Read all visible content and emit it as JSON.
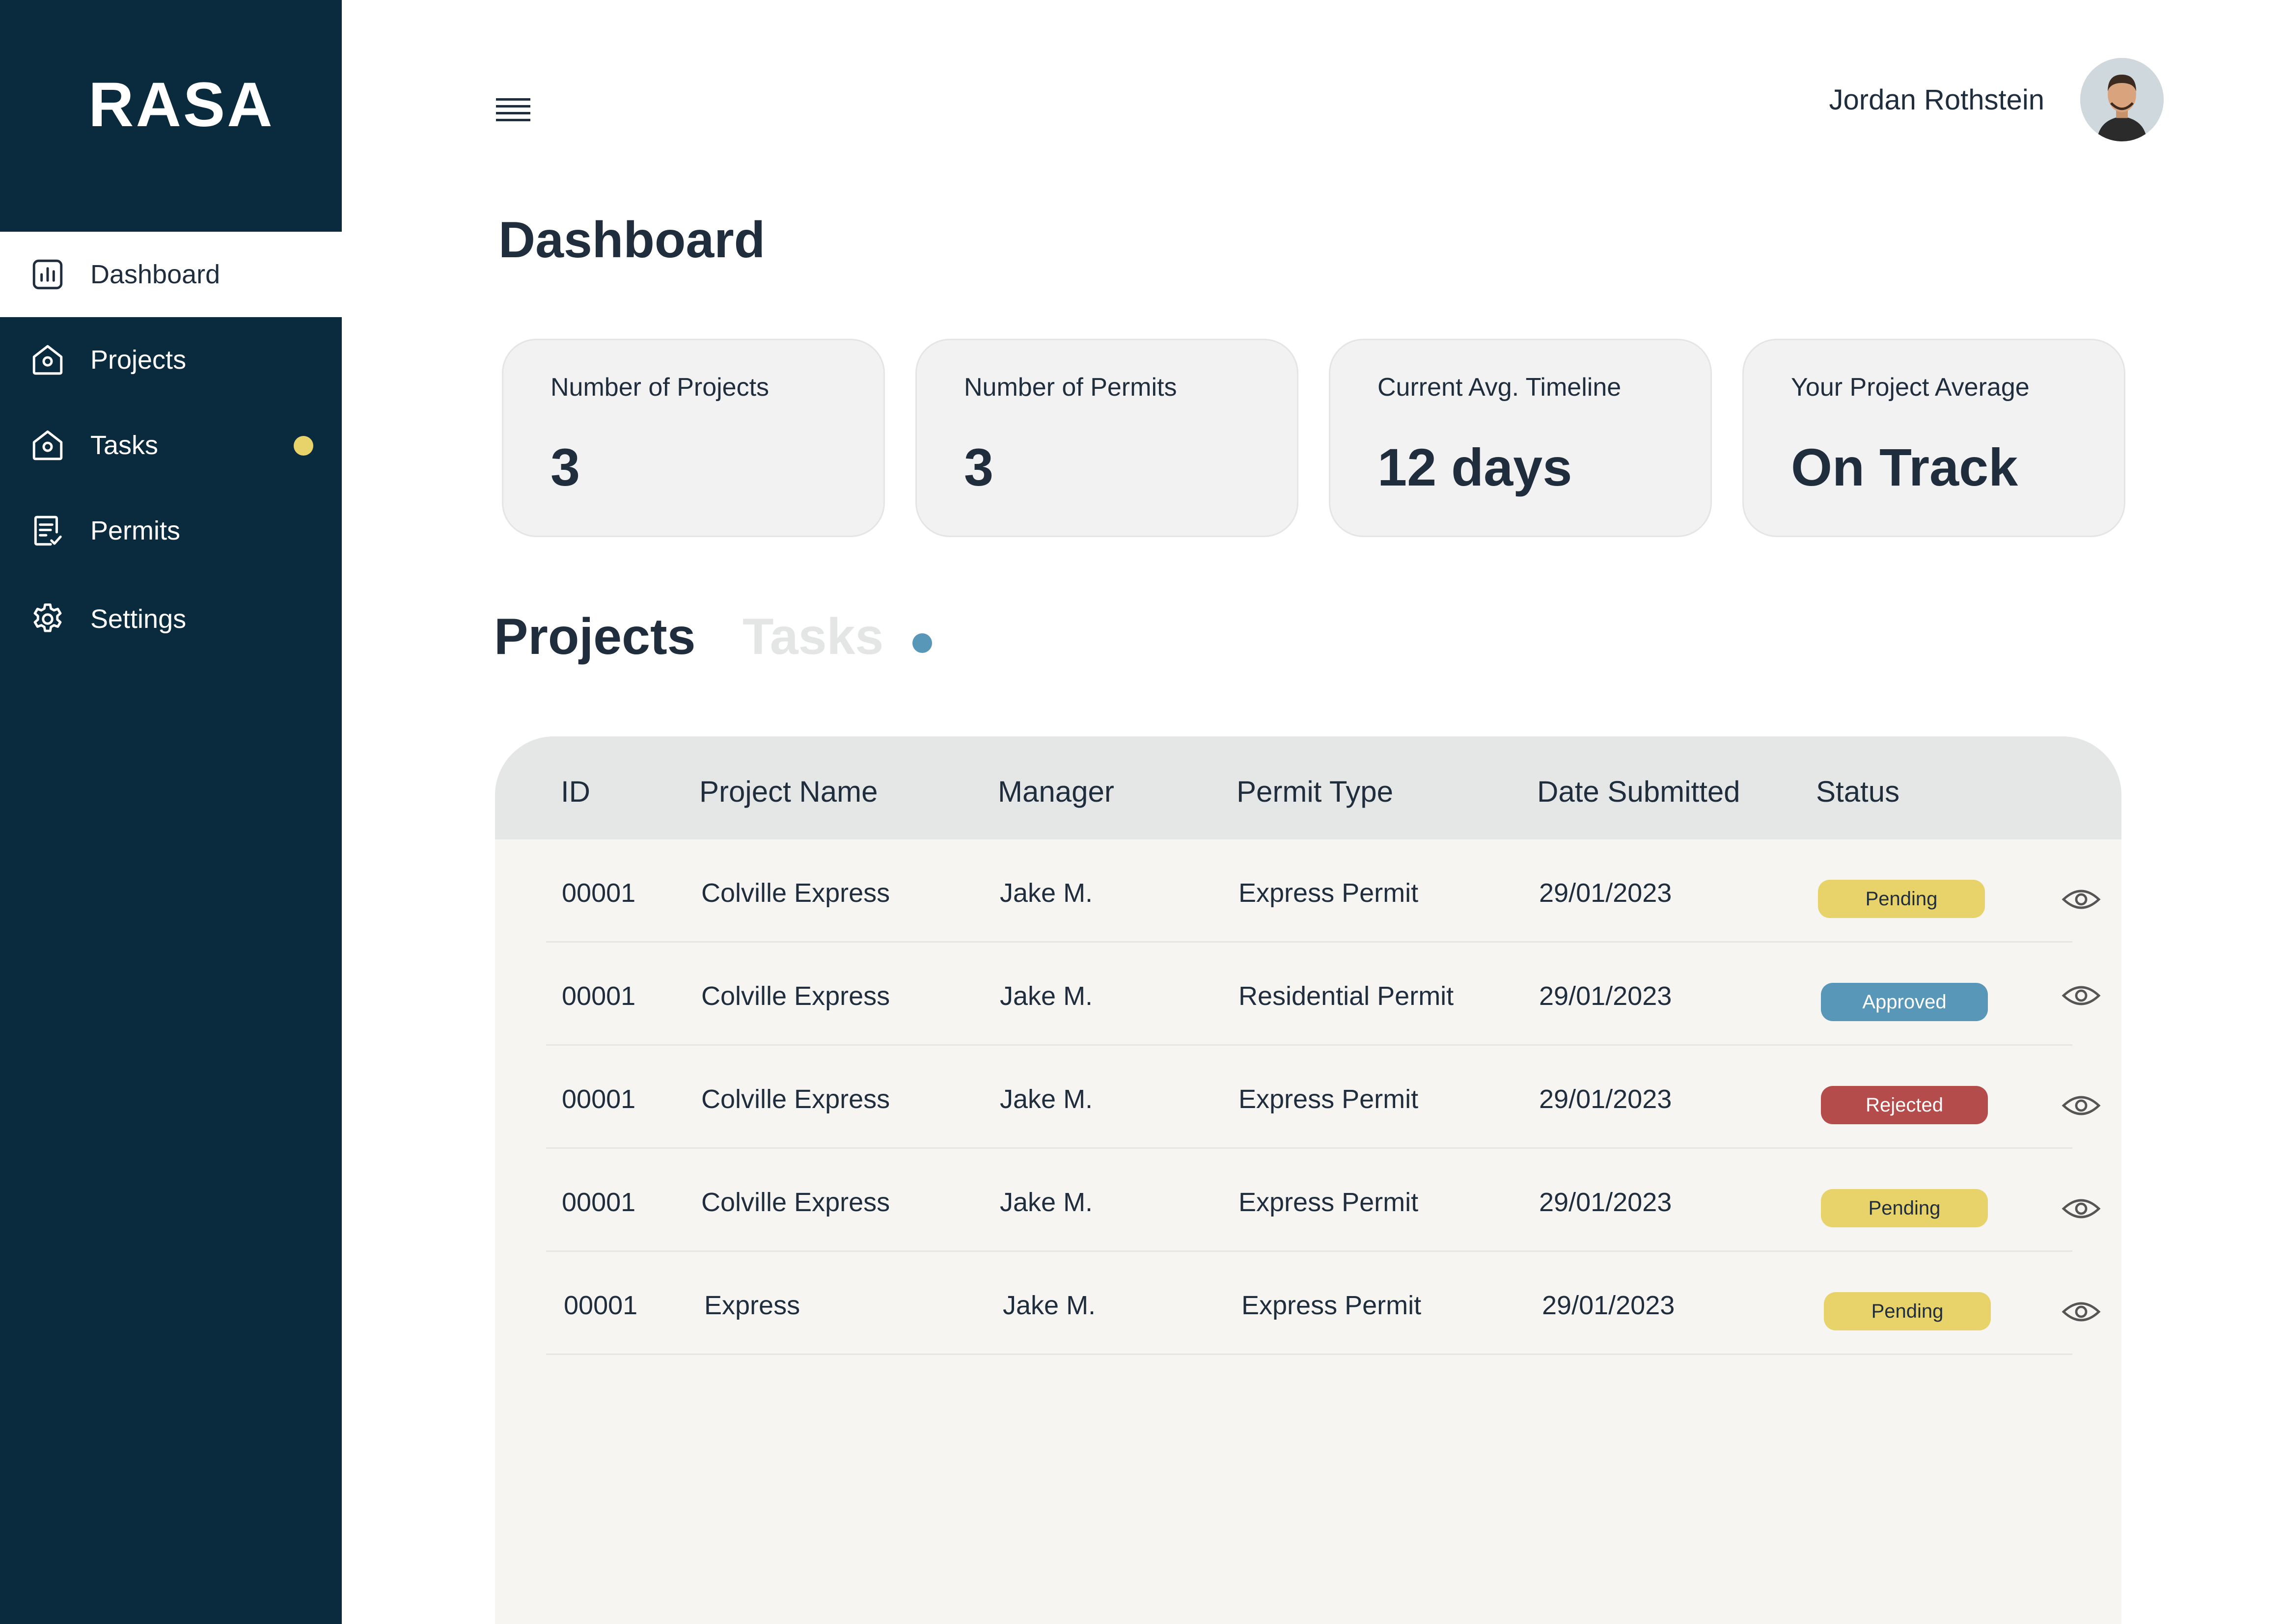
{
  "app": {
    "logo": "RASA"
  },
  "sidebar": {
    "items": [
      {
        "label": "Dashboard",
        "icon": "bar-chart-icon",
        "active": true
      },
      {
        "label": "Projects",
        "icon": "house-icon",
        "active": false
      },
      {
        "label": "Tasks",
        "icon": "house-icon",
        "active": false,
        "notification_dot": true
      },
      {
        "label": "Permits",
        "icon": "document-check-icon",
        "active": false
      },
      {
        "label": "Settings",
        "icon": "gear-icon",
        "active": false
      }
    ]
  },
  "header": {
    "menu_icon": "hamburger-menu-icon",
    "user_name": "Jordan Rothstein",
    "avatar_icon": "user-avatar"
  },
  "page": {
    "title": "Dashboard"
  },
  "stats": [
    {
      "label": "Number of Projects",
      "value": "3"
    },
    {
      "label": "Number of Permits",
      "value": "3"
    },
    {
      "label": "Current Avg. Timeline",
      "value": "12 days"
    },
    {
      "label": "Your Project Average",
      "value": "On Track"
    }
  ],
  "tabs": [
    {
      "label": "Projects",
      "active": true
    },
    {
      "label": "Tasks",
      "active": false,
      "notification_dot": true
    }
  ],
  "table": {
    "columns": [
      "ID",
      "Project Name",
      "Manager",
      "Permit Type",
      "Date Submitted",
      "Status"
    ],
    "rows": [
      {
        "id": "00001",
        "project": "Colville Express",
        "manager": "Jake M.",
        "permit": "Express Permit",
        "date": "29/01/2023",
        "status": "Pending"
      },
      {
        "id": "00001",
        "project": "Colville Express",
        "manager": "Jake M.",
        "permit": "Residential Permit",
        "date": "29/01/2023",
        "status": "Approved"
      },
      {
        "id": "00001",
        "project": "Colville Express",
        "manager": "Jake M.",
        "permit": "Express Permit",
        "date": "29/01/2023",
        "status": "Rejected"
      },
      {
        "id": "00001",
        "project": "Colville Express",
        "manager": "Jake M.",
        "permit": "Express Permit",
        "date": "29/01/2023",
        "status": "Pending"
      },
      {
        "id": "00001",
        "project": "Express",
        "manager": "Jake M.",
        "permit": "Express Permit",
        "date": "29/01/2023",
        "status": "Pending"
      }
    ],
    "row_action_icon": "eye-icon"
  },
  "colors": {
    "sidebar_bg": "#0a2a3d",
    "text_dark": "#1f2d3d",
    "pending": "#e8d36b",
    "approved": "#5897b8",
    "rejected": "#b54c4c",
    "notification_dot_sidebar": "#e8d36b",
    "notification_dot_tab": "#5897b8",
    "card_bg": "#f2f2f2",
    "table_header_bg": "#e5e7e6",
    "table_bg": "#f6f5f2"
  }
}
